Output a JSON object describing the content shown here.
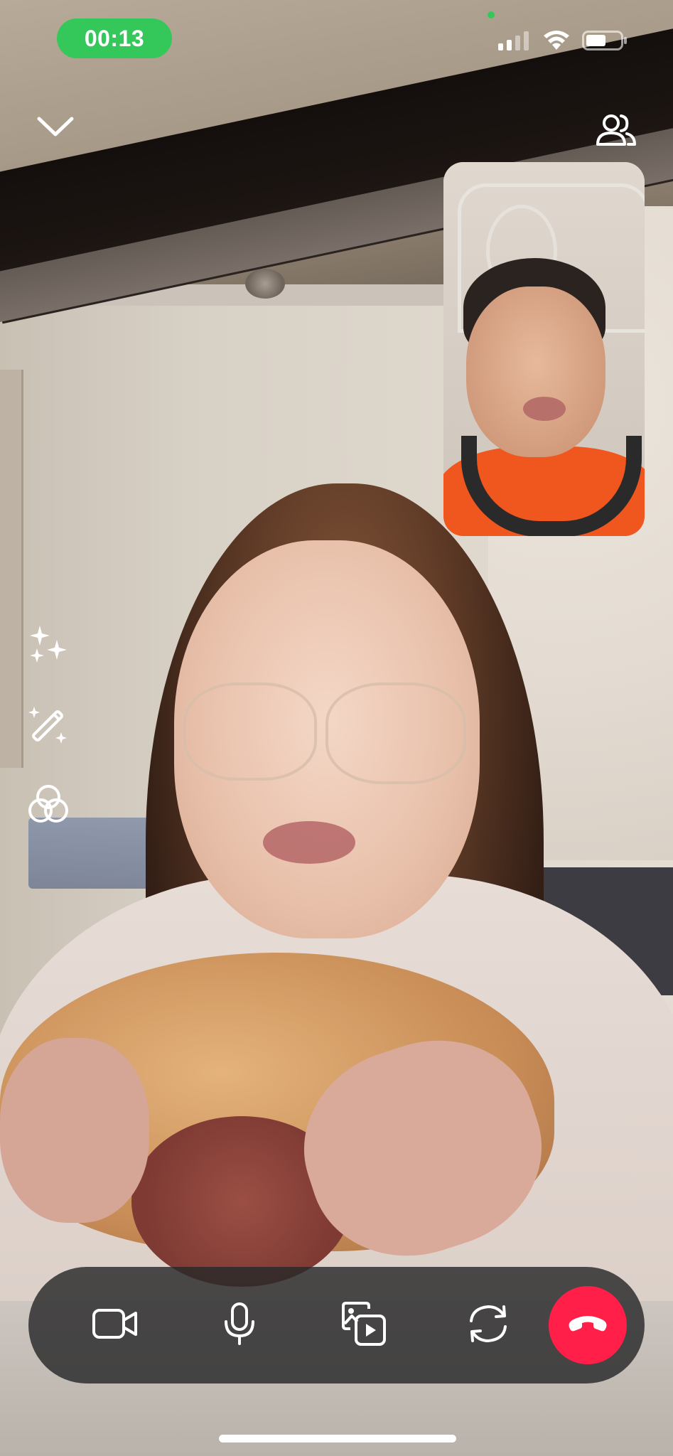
{
  "status_bar": {
    "call_timer": "00:13",
    "signal_icon": "cellular-signal-icon",
    "wifi_icon": "wifi-icon",
    "battery_icon": "battery-icon",
    "battery_level": 0.55,
    "privacy_indicator_color": "#34c759"
  },
  "top_controls": {
    "collapse_icon": "chevron-down-icon",
    "participants_icon": "participants-icon"
  },
  "self_view": {
    "label": ""
  },
  "side_tools": [
    {
      "name": "effects",
      "icon": "sparkles-icon"
    },
    {
      "name": "retouch",
      "icon": "magic-wand-icon"
    },
    {
      "name": "filters",
      "icon": "filters-icon"
    }
  ],
  "call_controls": [
    {
      "name": "camera",
      "icon": "video-camera-icon"
    },
    {
      "name": "microphone",
      "icon": "microphone-icon"
    },
    {
      "name": "share-media",
      "icon": "share-media-icon"
    },
    {
      "name": "flip-camera",
      "icon": "flip-camera-icon"
    },
    {
      "name": "end-call",
      "icon": "end-call-icon"
    }
  ],
  "colors": {
    "timer_pill": "#34c759",
    "end_call": "#ff1f48",
    "controls_bar": "#28282a"
  }
}
